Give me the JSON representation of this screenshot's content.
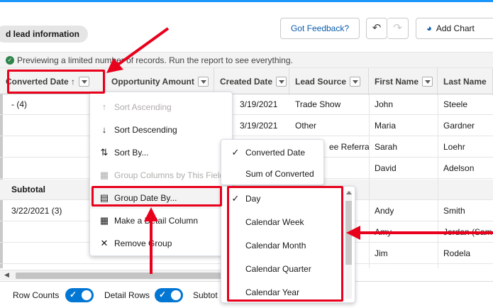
{
  "breadcrumb": "d lead information",
  "toolbar": {
    "feedback_label": "Got Feedback?",
    "undo_glyph": "↶",
    "redo_glyph": "↷",
    "add_chart_label": "Add Chart"
  },
  "notice": {
    "text": "Previewing a limited number of records. Run the report to see everything."
  },
  "columns": [
    {
      "label": "Converted Date",
      "sort": "↑"
    },
    {
      "label": "Opportunity Amount"
    },
    {
      "label": "Created Date"
    },
    {
      "label": "Lead Source"
    },
    {
      "label": "First Name"
    },
    {
      "label": "Last Name"
    }
  ],
  "groups": {
    "g1": "- (4)",
    "subtotal": "Subtotal",
    "g2": "3/22/2021 (3)"
  },
  "rows": [
    {
      "created": "3/19/2021",
      "source": "Trade Show",
      "first": "John",
      "last": "Steele"
    },
    {
      "created": "3/19/2021",
      "source": "Other",
      "first": "Maria",
      "last": "Gardner"
    },
    {
      "created": "",
      "source": "ee Referral",
      "first": "Sarah",
      "last": "Loehr"
    },
    {
      "created": "",
      "source": "",
      "first": "David",
      "last": "Adelson"
    },
    {
      "created": "",
      "source": "",
      "first": "Andy",
      "last": "Smith"
    },
    {
      "created": "",
      "source": "",
      "first": "Amy",
      "last": "Jordan (Sam"
    },
    {
      "created": "",
      "source": "",
      "first": "Jim",
      "last": "Rodela"
    }
  ],
  "menu_main": [
    {
      "label": "Sort Ascending",
      "icon": "↑",
      "disabled": true
    },
    {
      "label": "Sort Descending",
      "icon": "↓",
      "disabled": false
    },
    {
      "label": "Sort By...",
      "icon": "⇅",
      "disabled": false,
      "submenu": true
    },
    {
      "label": "Group Columns by This Field",
      "icon": "▦",
      "disabled": true
    },
    {
      "label": "Group Date By...",
      "icon": "▤",
      "disabled": false,
      "submenu": true
    },
    {
      "label": "Make a Detail Column",
      "icon": "▦",
      "disabled": false
    },
    {
      "label": "Remove Group",
      "icon": "✕",
      "disabled": false
    }
  ],
  "menu_sort_by": [
    {
      "label": "Converted Date",
      "checked": true
    },
    {
      "label": "Sum of Converted",
      "checked": false
    }
  ],
  "menu_group_date": [
    {
      "label": "Day",
      "checked": true
    },
    {
      "label": "Calendar Week",
      "checked": false
    },
    {
      "label": "Calendar Month",
      "checked": false
    },
    {
      "label": "Calendar Quarter",
      "checked": false
    },
    {
      "label": "Calendar Year",
      "checked": false
    }
  ],
  "footer": {
    "row_counts": "Row Counts",
    "detail_rows": "Detail Rows",
    "subtotals": "Subtot"
  },
  "colors": {
    "accent": "#0176d3",
    "annotation": "#e8001c"
  }
}
